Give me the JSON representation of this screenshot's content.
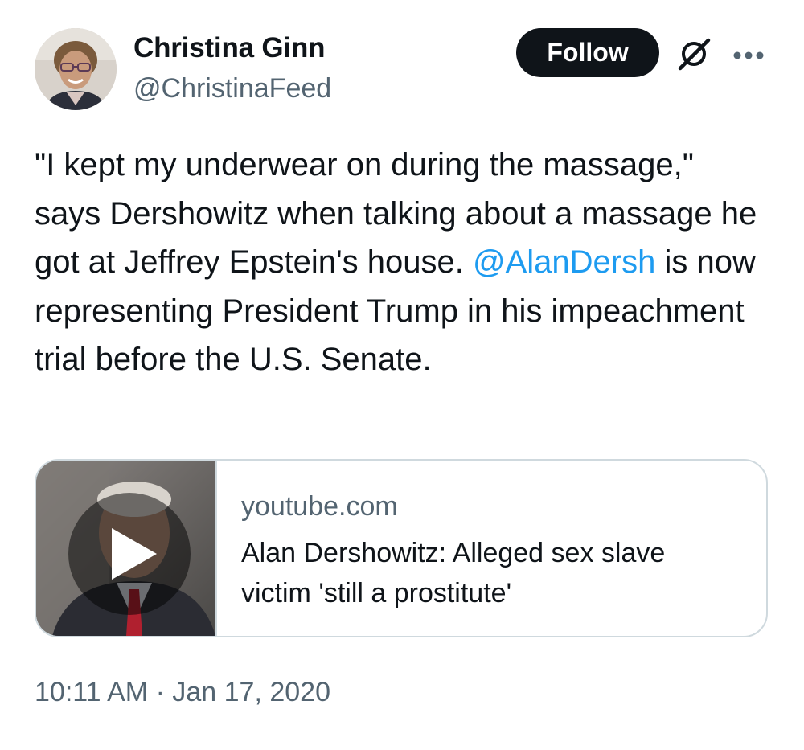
{
  "author": {
    "display_name": "Christina Ginn",
    "handle": "@ChristinaFeed"
  },
  "header": {
    "follow_label": "Follow",
    "grok_icon": "grok-icon",
    "more_icon": "more-options-icon"
  },
  "tweet": {
    "text_part1": "\"I kept my underwear on during the massage,\" says Dershowitz when talking about a massage he got at Jeffrey Epstein's house. ",
    "mention": "@AlanDersh",
    "text_part2": " is now representing President Trump in his impeachment trial before the U.S. Senate."
  },
  "card": {
    "domain": "youtube.com",
    "title": "Alan Dershowitz: Alleged sex slave victim 'still a prostitute'",
    "play_icon": "play-icon"
  },
  "meta": {
    "time": "10:11 AM",
    "separator": " · ",
    "date": "Jan 17, 2020"
  },
  "colors": {
    "text": "#0f1419",
    "secondary": "#536471",
    "link": "#1d9bf0",
    "border": "#cfd9de",
    "button_bg": "#0f1419"
  }
}
